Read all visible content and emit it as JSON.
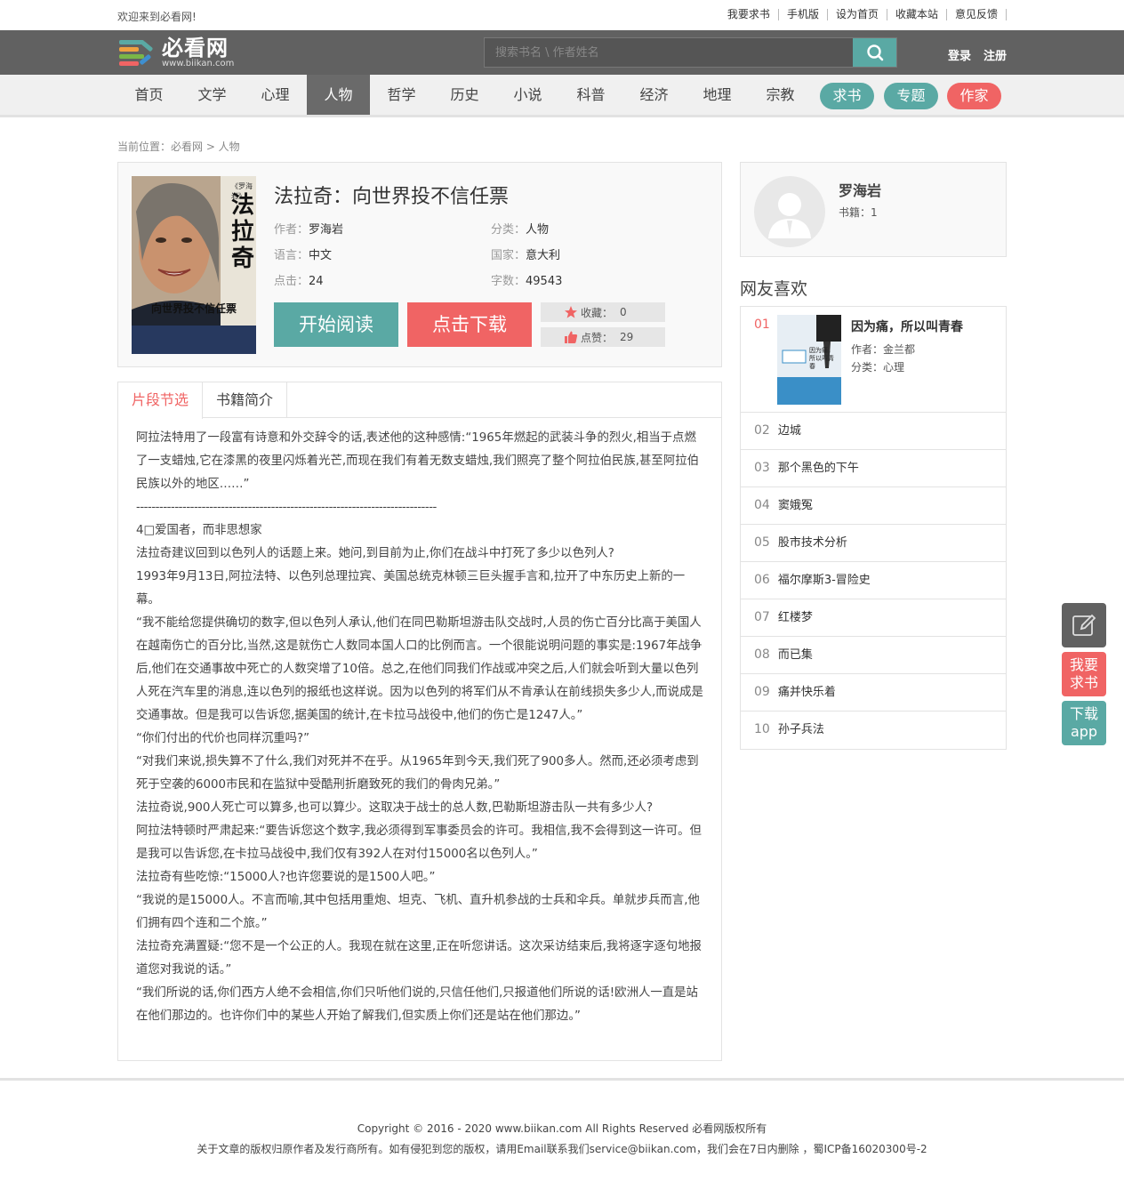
{
  "topbar": {
    "welcome": "欢迎来到必看网!",
    "links": [
      "我要求书",
      "手机版",
      "设为首页",
      "收藏本站",
      "意见反馈"
    ]
  },
  "header": {
    "logo_cn": "必看网",
    "logo_url": "www.biikan.com",
    "search_placeholder": "搜索书名 \\ 作者姓名",
    "login": "登录",
    "register": "注册"
  },
  "nav": {
    "items": [
      "首页",
      "文学",
      "心理",
      "人物",
      "哲学",
      "历史",
      "小说",
      "科普",
      "经济",
      "地理",
      "宗教"
    ],
    "active_index": 3,
    "pills": [
      {
        "label": "求书",
        "color": "#5aa9a4"
      },
      {
        "label": "专题",
        "color": "#5aa9a4"
      },
      {
        "label": "作家",
        "color": "#f06464"
      }
    ]
  },
  "breadcrumb": "当前位置：必看网 > 人物",
  "book": {
    "title": "法拉奇：向世界投不信任票",
    "author_label": "作者：",
    "author": "罗海岩",
    "category_label": "分类：",
    "category": "人物",
    "language_label": "语言：",
    "language": "中文",
    "country_label": "国家：",
    "country": "意大利",
    "clicks_label": "点击：",
    "clicks": "24",
    "words_label": "字数：",
    "words": "49543",
    "read_button": "开始阅读",
    "download_button": "点击下载",
    "favorites_label": "收藏：",
    "favorites": "0",
    "likes_label": "点赞：",
    "likes": "29",
    "cover_text": {
      "title_chars": "法拉奇",
      "subtitle": "向世界投不信任票",
      "publisher_tag": "《罗海岩》"
    }
  },
  "tabs": [
    "片段节选",
    "书籍简介"
  ],
  "excerpt": [
    "阿拉法特用了一段富有诗意和外交辞令的话,表述他的这种感情:“1965年燃起的武装斗争的烈火,相当于点燃了一支蜡烛,它在漆黑的夜里闪烁着光芒,而现在我们有着无数支蜡烛,我们照亮了整个阿拉伯民族,甚至阿拉伯民族以外的地区……”",
    "------------------------------------------------------------------------------",
    "4□爱国者，而非思想家",
    "法拉奇建议回到以色列人的话题上来。她问,到目前为止,你们在战斗中打死了多少以色列人?",
    "1993年9月13日,阿拉法特、以色列总理拉宾、美国总统克林顿三巨头握手言和,拉开了中东历史上新的一幕。",
    "“我不能给您提供确切的数字,但以色列人承认,他们在同巴勒斯坦游击队交战时,人员的伤亡百分比高于美国人在越南伤亡的百分比,当然,这是就伤亡人数同本国人口的比例而言。一个很能说明问题的事实是:1967年战争后,他们在交通事故中死亡的人数突增了10倍。总之,在他们同我们作战或冲突之后,人们就会听到大量以色列人死在汽车里的消息,连以色列的报纸也这样说。因为以色列的将军们从不肯承认在前线损失多少人,而说成是交通事故。但是我可以告诉您,据美国的统计,在卡拉马战役中,他们的伤亡是1247人。”",
    "“你们付出的代价也同样沉重吗?”",
    "“对我们来说,损失算不了什么,我们对死并不在乎。从1965年到今天,我们死了900多人。然而,还必须考虑到死于空袭的6000市民和在监狱中受酷刑折磨致死的我们的骨肉兄弟。”",
    "法拉奇说,900人死亡可以算多,也可以算少。这取决于战士的总人数,巴勒斯坦游击队一共有多少人?",
    "阿拉法特顿时严肃起来:“要告诉您这个数字,我必须得到军事委员会的许可。我相信,我不会得到这一许可。但是我可以告诉您,在卡拉马战役中,我们仅有392人在对付15000名以色列人。”",
    "法拉奇有些吃惊:“15000人?也许您要说的是1500人吧。”",
    "“我说的是15000人。不言而喻,其中包括用重炮、坦克、飞机、直升机参战的士兵和伞兵。单就步兵而言,他们拥有四个连和二个旅。”",
    "法拉奇充满置疑:“您不是一个公正的人。我现在就在这里,正在听您讲话。这次采访结束后,我将逐字逐句地报道您对我说的话。”",
    "“我们所说的话,你们西方人绝不会相信,你们只听他们说的,只信任他们,只报道他们所说的话!欧洲人一直是站在他们那边的。也许你们中的某些人开始了解我们,但实质上你们还是站在他们那边。”"
  ],
  "author_card": {
    "name": "罗海岩",
    "count_label": "书籍：",
    "count": "1"
  },
  "recommend": {
    "title": "网友喜欢",
    "top": {
      "num": "01",
      "title": "因为痛，所以叫青春",
      "author_label": "作者：",
      "author": "金兰都",
      "category_label": "分类：",
      "category": "心理",
      "cover_text": "因为痛，所以叫青春"
    },
    "items": [
      {
        "num": "02",
        "title": "边城"
      },
      {
        "num": "03",
        "title": "那个黑色的下午"
      },
      {
        "num": "04",
        "title": "窦娥冤"
      },
      {
        "num": "05",
        "title": "股市技术分析"
      },
      {
        "num": "06",
        "title": "福尔摩斯3-冒险史"
      },
      {
        "num": "07",
        "title": "红楼梦"
      },
      {
        "num": "08",
        "title": "而已集"
      },
      {
        "num": "09",
        "title": "痛并快乐着"
      },
      {
        "num": "10",
        "title": "孙子兵法"
      }
    ]
  },
  "float_buttons": {
    "request_l1": "我要",
    "request_l2": "求书",
    "app_l1": "下载",
    "app_l2": "app"
  },
  "footer": {
    "copyright": "Copyright © 2016 - 2020 www.biikan.com All Rights Reserved 必看网版权所有",
    "notice": "关于文章的版权归原作者及发行商所有。如有侵犯到您的版权，请用Email联系我们service@biikan.com，我们会在7日内删除 ，蜀ICP备16020300号-2"
  },
  "colors": {
    "teal": "#5aa9a4",
    "red": "#f06464",
    "header_bg": "#616161",
    "nav_active": "#6a6a6a"
  }
}
